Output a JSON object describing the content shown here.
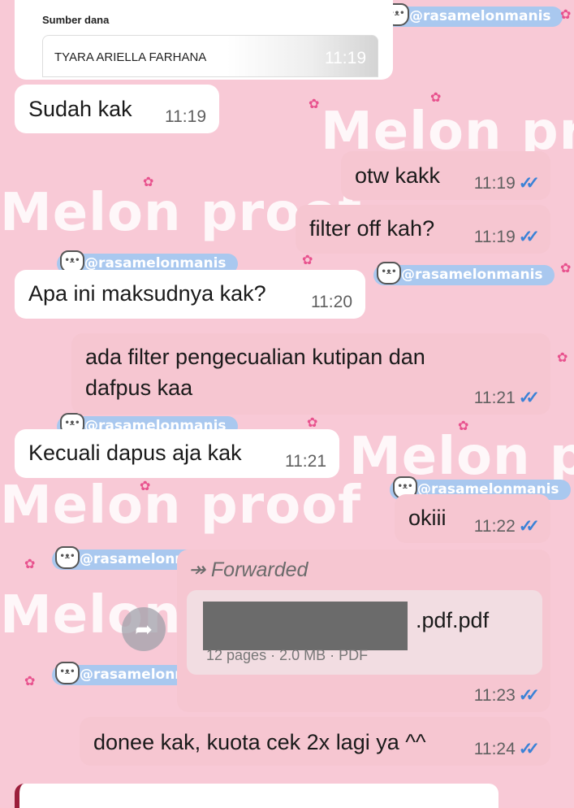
{
  "top_card": {
    "label": "Sumber dana",
    "account_name": "TYARA ARIELLA FARHANA",
    "time": "11:19"
  },
  "messages": [
    {
      "id": "m1",
      "dir": "in",
      "text": "Sudah kak",
      "time": "11:19"
    },
    {
      "id": "m2",
      "dir": "out",
      "text": "otw kakk",
      "time": "11:19",
      "status": "read"
    },
    {
      "id": "m3",
      "dir": "out",
      "text": "filter off kah?",
      "time": "11:19",
      "status": "read"
    },
    {
      "id": "m4",
      "dir": "in",
      "text": "Apa ini maksudnya kak?",
      "time": "11:20"
    },
    {
      "id": "m5",
      "dir": "out",
      "text": "ada filter pengecualian kutipan dan dafpus kaa",
      "time": "11:21",
      "status": "read"
    },
    {
      "id": "m6",
      "dir": "in",
      "text": "Kecuali dapus aja kak",
      "time": "11:21"
    },
    {
      "id": "m7",
      "dir": "out",
      "text": "okiii",
      "time": "11:22",
      "status": "read"
    },
    {
      "id": "m9",
      "dir": "out",
      "text": "donee kak, kuota cek 2x lagi ya ^^",
      "time": "11:24",
      "status": "read"
    }
  ],
  "forwarded_doc": {
    "forwarded_label": "Forwarded",
    "file_name_suffix": ".pdf.pdf",
    "meta": "12 pages · 2.0 MB · PDF",
    "time": "11:23",
    "status": "read"
  },
  "wallpaper": {
    "brand_text": "Melon proof",
    "handle": "@rasamelonmanis"
  },
  "colors": {
    "background": "#f8c9d6",
    "incoming": "#ffffff",
    "outgoing": "#f6c6d1",
    "read_ticks": "#3b82d6"
  },
  "icons": {
    "read_status": "double-check-icon",
    "forward": "forward-arrow-icon"
  }
}
